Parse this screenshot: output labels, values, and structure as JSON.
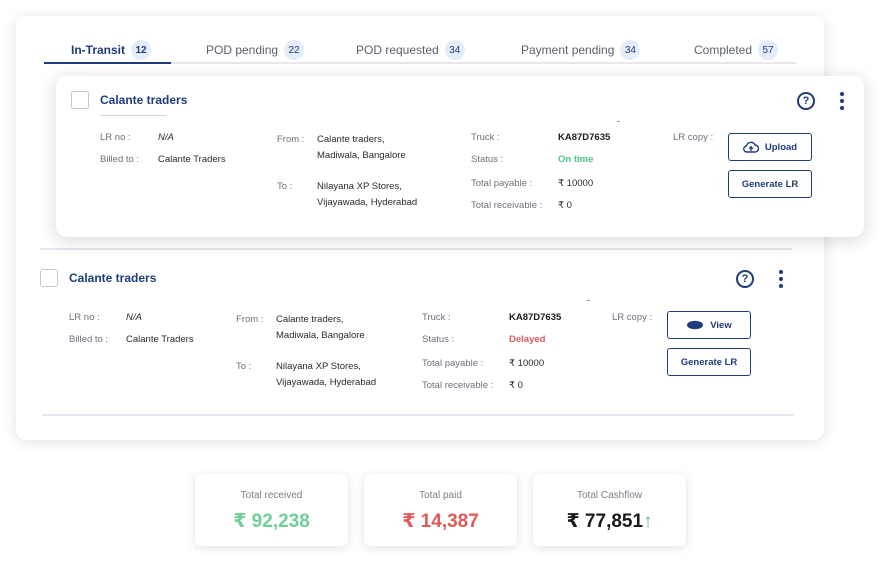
{
  "tabs": [
    {
      "label": "In-Transit",
      "count": "12"
    },
    {
      "label": "POD pending",
      "count": "22"
    },
    {
      "label": "POD requested",
      "count": "34"
    },
    {
      "label": "Payment pending",
      "count": "34"
    },
    {
      "label": "Completed",
      "count": "57"
    }
  ],
  "labels": {
    "lr_no": "LR no :",
    "billed_to": "Billed to :",
    "from": "From :",
    "to": "To :",
    "truck": "Truck :",
    "status": "Status :",
    "total_payable": "Total payable :",
    "total_receivable": "Total receivable :",
    "lr_copy": "LR copy :",
    "generate_lr": "Generate LR",
    "help": "?"
  },
  "shipments": [
    {
      "company": "Calante traders",
      "lr_no": "N/A",
      "billed_to": "Calante Traders",
      "from_line1": "Calante traders,",
      "from_line2": "Madiwala, Bangalore",
      "to_line1": "Nilayana XP Stores,",
      "to_line2": "Vijayawada, Hyderabad",
      "truck": "KA87D7635",
      "status": "On time",
      "status_color": "#4cc38a",
      "total_payable": "₹ 10000",
      "total_receivable": "₹ 0",
      "lr_action": "Upload",
      "lr_action_icon": "upload-cloud-icon"
    },
    {
      "company": "Calante traders",
      "lr_no": "N/A",
      "billed_to": "Calante Traders",
      "from_line1": "Calante traders,",
      "from_line2": "Madiwala, Bangalore",
      "to_line1": "Nilayana XP Stores,",
      "to_line2": "Vijayawada, Hyderabad",
      "truck": "KA87D7635",
      "status": "Delayed",
      "status_color": "#e05a5a",
      "total_payable": "₹ 10000",
      "total_receivable": "₹ 0",
      "lr_action": "View",
      "lr_action_icon": "eye-icon"
    }
  ],
  "summary": {
    "received_label": "Total received",
    "received_value": "₹ 92,238",
    "paid_label": "Total paid",
    "paid_value": "₹ 14,387",
    "cashflow_label": "Total Cashflow",
    "cashflow_value": "₹ 77,851",
    "cashflow_trend": "↑"
  },
  "colors": {
    "brand": "#1f3c7a",
    "positive": "#6fcf97",
    "negative": "#e05a5a"
  }
}
